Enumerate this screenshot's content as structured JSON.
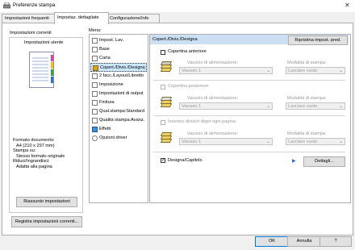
{
  "window": {
    "title": "Preferenze stampa"
  },
  "tabs": [
    {
      "label": "Impostazioni frequenti"
    },
    {
      "label": "Impostaz. dettagliate"
    },
    {
      "label": "Configurazione/Info"
    }
  ],
  "left": {
    "group_label": "Impostazioni correnti",
    "preset_label": "Impostazioni utente",
    "info": [
      "Formato documento:",
      "A4 (210 x 297 mm)",
      "Stampa su:",
      "Stesso formato originale",
      "Riduci/Ingrandisci:",
      "Adatta alla pagina"
    ],
    "summary_button": "Riassunto impostazioni",
    "register_button": "Registra impostazioni correnti..."
  },
  "menu": {
    "label": "Menu:",
    "items": [
      {
        "label": "Impost. Lav."
      },
      {
        "label": "Base"
      },
      {
        "label": "Carta"
      },
      {
        "label": "Copert./Divis./Designa"
      },
      {
        "label": "2 facc./Layout/Libretto"
      },
      {
        "label": "Imposizione"
      },
      {
        "label": "Impostazioni di output"
      },
      {
        "label": "Finitura"
      },
      {
        "label": "Qual.stampa:Standard"
      },
      {
        "label": "Qualità stampa:Avanz."
      },
      {
        "label": "Effetti"
      },
      {
        "label": "Opzioni driver"
      }
    ]
  },
  "right": {
    "header": "Copert./Divis./Designa",
    "reset_button": "Ripristina impost. pred.",
    "sections": [
      {
        "check_label": "Copertina anteriore",
        "tray_label": "Vassoio di alimentazione:",
        "tray_value": "Vassoio 1",
        "mode_label": "Modalità di stampa:",
        "mode_value": "Lasciare vuoto"
      },
      {
        "check_label": "Copertina posteriore",
        "tray_label": "Vassoio di alimentazione:",
        "tray_value": "Vassoio 1",
        "mode_label": "Modalità di stampa:",
        "mode_value": "Lasciare vuoto"
      },
      {
        "check_label": "Inserisci divisori dopo ogni pagina",
        "tray_label": "Vassoio di alimentazione:",
        "tray_value": "Vassoio 1",
        "mode_label": "Modalità di stampa:",
        "mode_value": "Lasciare vuoto"
      }
    ],
    "designate_label": "Designa/Capitolo",
    "details_button": "Dettagli..."
  },
  "footer": {
    "ok": "OK",
    "cancel": "Annulla",
    "help": "?"
  },
  "colors": {
    "selection": "#cce8ff",
    "header": "#cbe0f3",
    "accent": "#0078d7",
    "list_icon": "#d9a21f"
  }
}
